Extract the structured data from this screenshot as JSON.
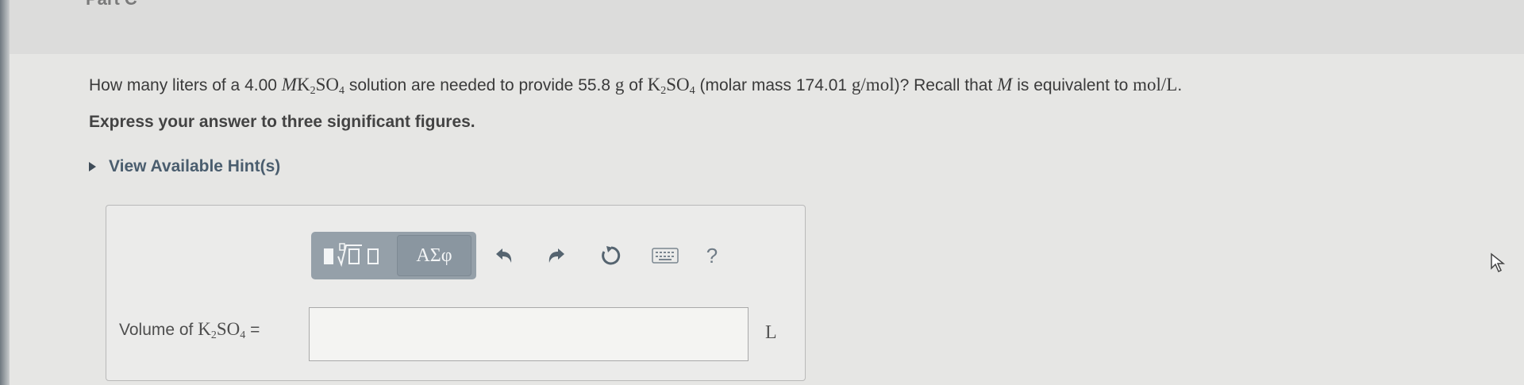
{
  "header": {
    "part_label": "Part C"
  },
  "question": {
    "q1": "How many liters of a 4.00",
    "q2": "M",
    "q3": "K",
    "q4": "2",
    "q5": "SO",
    "q6": "4",
    "q7": "solution are needed to provide 55.8",
    "q8": "g",
    "q9": "of",
    "q10": "K",
    "q11": "2",
    "q12": "SO",
    "q13": "4",
    "q14": "(molar mass 174.01",
    "q15": "g/mol",
    "q16": ")? Recall that",
    "q17": "M",
    "q18": "is equivalent to",
    "q19": "mol/L",
    "q20": "."
  },
  "instruction": "Express your answer to three significant figures.",
  "hints": {
    "label": "View Available Hint(s)"
  },
  "toolbar": {
    "symbols_label": "ΑΣφ",
    "help_label": "?",
    "icons": {
      "templates": "templates-icon",
      "undo": "undo-icon",
      "redo": "redo-icon",
      "reset": "reset-icon",
      "keyboard": "keyboard-icon"
    }
  },
  "answer": {
    "label_prefix": "Volume of",
    "label_el1": "K",
    "label_sub1": "2",
    "label_el2": "SO",
    "label_sub2": "4",
    "label_eq": "=",
    "value": "",
    "unit": "L"
  },
  "colors": {
    "toolbar_bg": "#95a0a9",
    "hint_link": "#4a5d6e",
    "page_bg": "#e6e6e4"
  }
}
